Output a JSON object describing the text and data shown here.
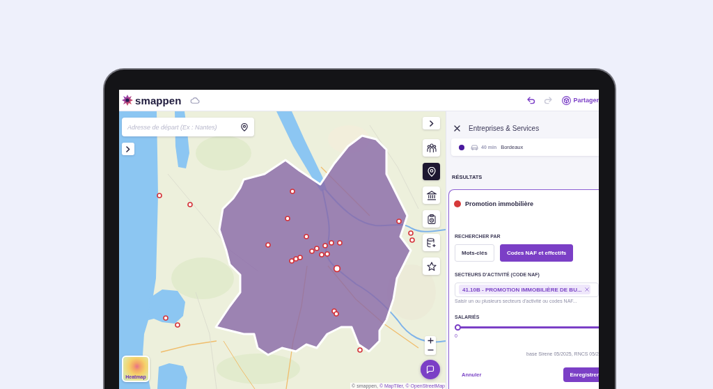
{
  "header": {
    "logo_text": "smappen",
    "history": [
      {
        "kind": "undo",
        "disabled": false
      },
      {
        "kind": "redo",
        "disabled": true
      }
    ],
    "share_label": "Partager"
  },
  "map": {
    "search": {
      "placeholder": "Adresse de départ (Ex : Nantes)"
    },
    "toolbar": [
      {
        "kind": "population",
        "selected": false
      },
      {
        "kind": "places",
        "selected": true
      },
      {
        "kind": "institutions",
        "selected": false
      },
      {
        "kind": "report",
        "selected": false
      },
      {
        "kind": "data",
        "selected": false
      },
      {
        "kind": "favorites",
        "selected": false
      }
    ],
    "heatmap_label": "Heatmap",
    "attribution": [
      {
        "kind": "text",
        "text": "© smappen,"
      },
      {
        "kind": "link",
        "text": "© MapTiler,"
      },
      {
        "kind": "link",
        "text": "© OpenStreetMap"
      }
    ]
  },
  "panel": {
    "title": "Entreprises & Services",
    "zone": {
      "color": "#4a1a9e",
      "travel_time": "40 min",
      "place": "Bordeaux"
    },
    "results_heading": "RÉSULTATS",
    "result": {
      "color": "#d63a3a",
      "name": "Promotion immobilière",
      "search_by": {
        "label": "RECHERCHER PAR",
        "options": [
          {
            "label": "Mots-clés",
            "selected": false
          },
          {
            "label": "Codes NAF et effectifs",
            "selected": true
          }
        ]
      },
      "sectors": {
        "label": "SECTEURS D'ACTIVITÉ (CODE NAF)",
        "tags": [
          "41.10B - PROMOTION IMMOBILIÈRE DE BU..."
        ],
        "hint": "Saisir un ou plusieurs secteurs d'activité ou codes NAF..."
      },
      "employees": {
        "label": "SALARIÉS",
        "level": 0,
        "reading": "0"
      },
      "source": "base Sirene 05/2025, RNCS 05/2",
      "actions": [
        {
          "kind": "secondary",
          "label": "Annuler"
        },
        {
          "kind": "primary",
          "label": "Enregistrer"
        }
      ]
    }
  }
}
